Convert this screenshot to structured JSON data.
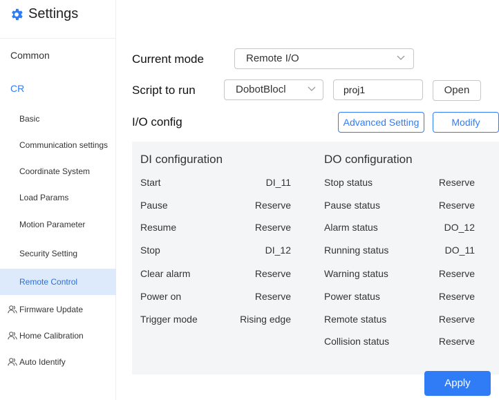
{
  "header": {
    "title": "Settings"
  },
  "sidebar": {
    "common": "Common",
    "cr": "CR",
    "sub_items": [
      "Basic",
      "Communication settings",
      "Coordinate System",
      "Load Params",
      "Motion Parameter",
      "Security Setting",
      "Remote Control"
    ],
    "person_items": [
      "Firmware Update",
      "Home Calibration",
      "Auto Identify"
    ]
  },
  "main": {
    "current_mode_label": "Current mode",
    "current_mode_value": "Remote I/O",
    "script_label": "Script to run",
    "script_value": "DobotBlocl",
    "project_value": "proj1",
    "open_button": "Open",
    "io_config_label": "I/O config",
    "advanced_button": "Advanced Setting",
    "modify_button": "Modify",
    "apply_button": "Apply"
  },
  "di": {
    "title": "DI configuration",
    "rows": [
      {
        "label": "Start",
        "value": "DI_11"
      },
      {
        "label": "Pause",
        "value": "Reserve"
      },
      {
        "label": "Resume",
        "value": "Reserve"
      },
      {
        "label": "Stop",
        "value": "DI_12"
      },
      {
        "label": "Clear alarm",
        "value": "Reserve"
      },
      {
        "label": "Power on",
        "value": "Reserve"
      },
      {
        "label": "Trigger mode",
        "value": "Rising edge"
      }
    ]
  },
  "do": {
    "title": "DO configuration",
    "rows": [
      {
        "label": "Stop status",
        "value": "Reserve"
      },
      {
        "label": "Pause status",
        "value": "Reserve"
      },
      {
        "label": "Alarm status",
        "value": "DO_12"
      },
      {
        "label": "Running status",
        "value": "DO_11"
      },
      {
        "label": "Warning status",
        "value": "Reserve"
      },
      {
        "label": "Power status",
        "value": "Reserve"
      },
      {
        "label": "Remote status",
        "value": "Reserve"
      },
      {
        "label": "Collision status",
        "value": "Reserve"
      }
    ]
  },
  "colors": {
    "accent": "#2f7cf6",
    "active_bg": "#ddeafb",
    "panel_bg": "#f4f5f7"
  },
  "icons": {
    "header": "gear-icon",
    "person": "person-icon",
    "dropdown": "chevron-down-icon"
  }
}
